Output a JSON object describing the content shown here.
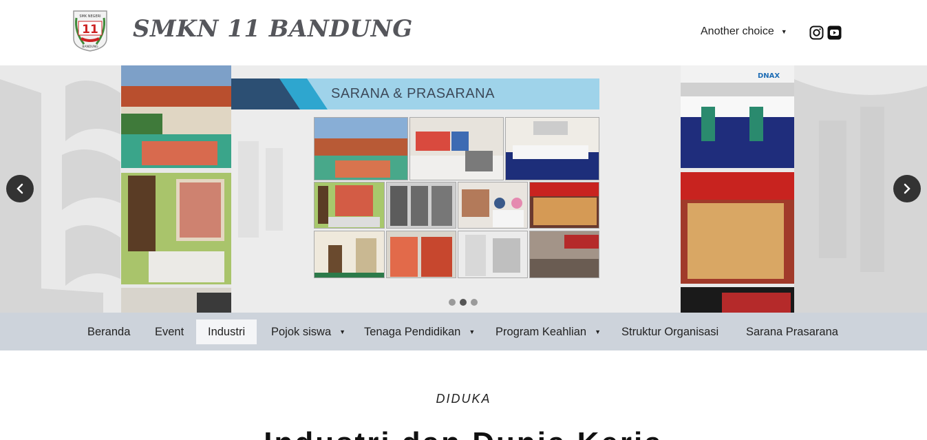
{
  "header": {
    "site_title": "SMKN 11 BANDUNG",
    "logo_text_top": "SMK NEGERI",
    "logo_number": "11",
    "logo_text_bottom": "BANDUNG",
    "menu_label": "Another choice",
    "social": [
      "instagram-icon",
      "youtube-icon"
    ]
  },
  "slider": {
    "banner_title": "SARANA & PRASARANA",
    "slide_count": 3,
    "active_slide": 2,
    "right_photo_sign": "DNAX"
  },
  "nav": {
    "items": [
      {
        "label": "Beranda",
        "has_dropdown": false,
        "active": false
      },
      {
        "label": "Event",
        "has_dropdown": false,
        "active": false
      },
      {
        "label": "Industri",
        "has_dropdown": false,
        "active": true
      },
      {
        "label": "Pojok siswa",
        "has_dropdown": true,
        "active": false
      },
      {
        "label": "Tenaga Pendidikan",
        "has_dropdown": true,
        "active": false
      },
      {
        "label": "Program Keahlian",
        "has_dropdown": true,
        "active": false
      },
      {
        "label": "Struktur Organisasi",
        "has_dropdown": false,
        "active": false
      },
      {
        "label": "Sarana Prasarana",
        "has_dropdown": false,
        "active": false
      }
    ]
  },
  "content": {
    "kicker": "DIDUKA",
    "headline": "Industri dan Dunia Kerja"
  },
  "colors": {
    "nav_bg": "#cdd3db",
    "banner_blue": "#9fd3ea",
    "banner_dark": "#2c4f73",
    "arrow_bg": "#333333"
  }
}
